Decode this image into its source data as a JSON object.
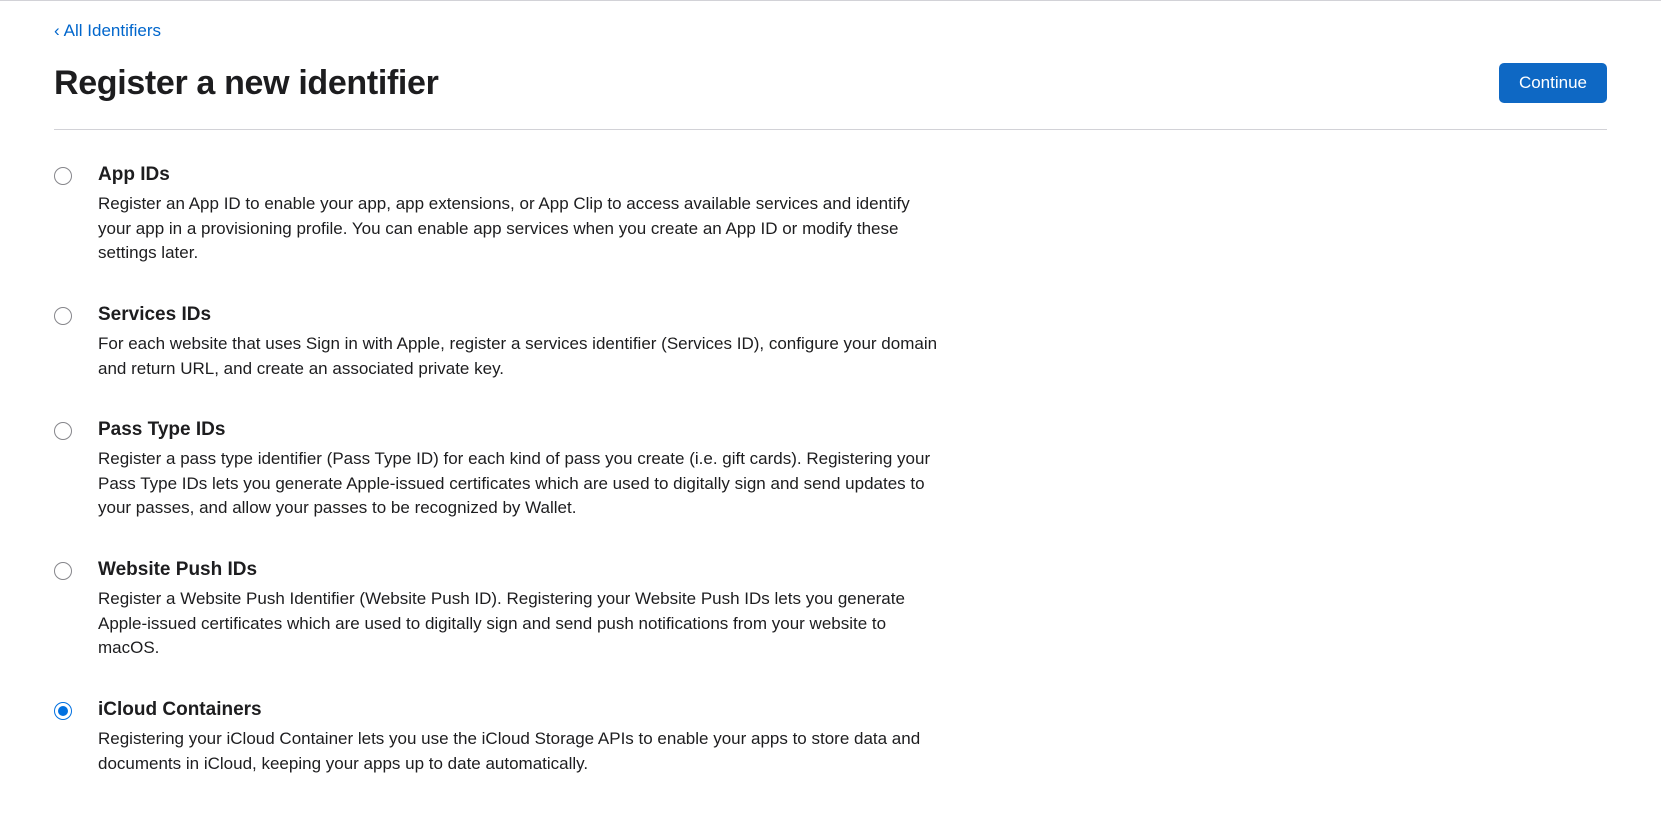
{
  "nav": {
    "back_label": "All Identifiers"
  },
  "header": {
    "title": "Register a new identifier",
    "continue_label": "Continue"
  },
  "options": [
    {
      "id": "app-ids",
      "selected": false,
      "title": "App IDs",
      "description": "Register an App ID to enable your app, app extensions, or App Clip to access available services and identify your app in a provisioning profile. You can enable app services when you create an App ID or modify these settings later."
    },
    {
      "id": "services-ids",
      "selected": false,
      "title": "Services IDs",
      "description": "For each website that uses Sign in with Apple, register a services identifier (Services ID), configure your domain and return URL, and create an associated private key."
    },
    {
      "id": "pass-type-ids",
      "selected": false,
      "title": "Pass Type IDs",
      "description": "Register a pass type identifier (Pass Type ID) for each kind of pass you create (i.e. gift cards). Registering your Pass Type IDs lets you generate Apple-issued certificates which are used to digitally sign and send updates to your passes, and allow your passes to be recognized by Wallet."
    },
    {
      "id": "website-push-ids",
      "selected": false,
      "title": "Website Push IDs",
      "description": "Register a Website Push Identifier (Website Push ID). Registering your Website Push IDs lets you generate Apple-issued certificates which are used to digitally sign and send push notifications from your website to macOS."
    },
    {
      "id": "icloud-containers",
      "selected": true,
      "title": "iCloud Containers",
      "description": "Registering your iCloud Container lets you use the iCloud Storage APIs to enable your apps to store data and documents in iCloud, keeping your apps up to date automatically."
    }
  ]
}
